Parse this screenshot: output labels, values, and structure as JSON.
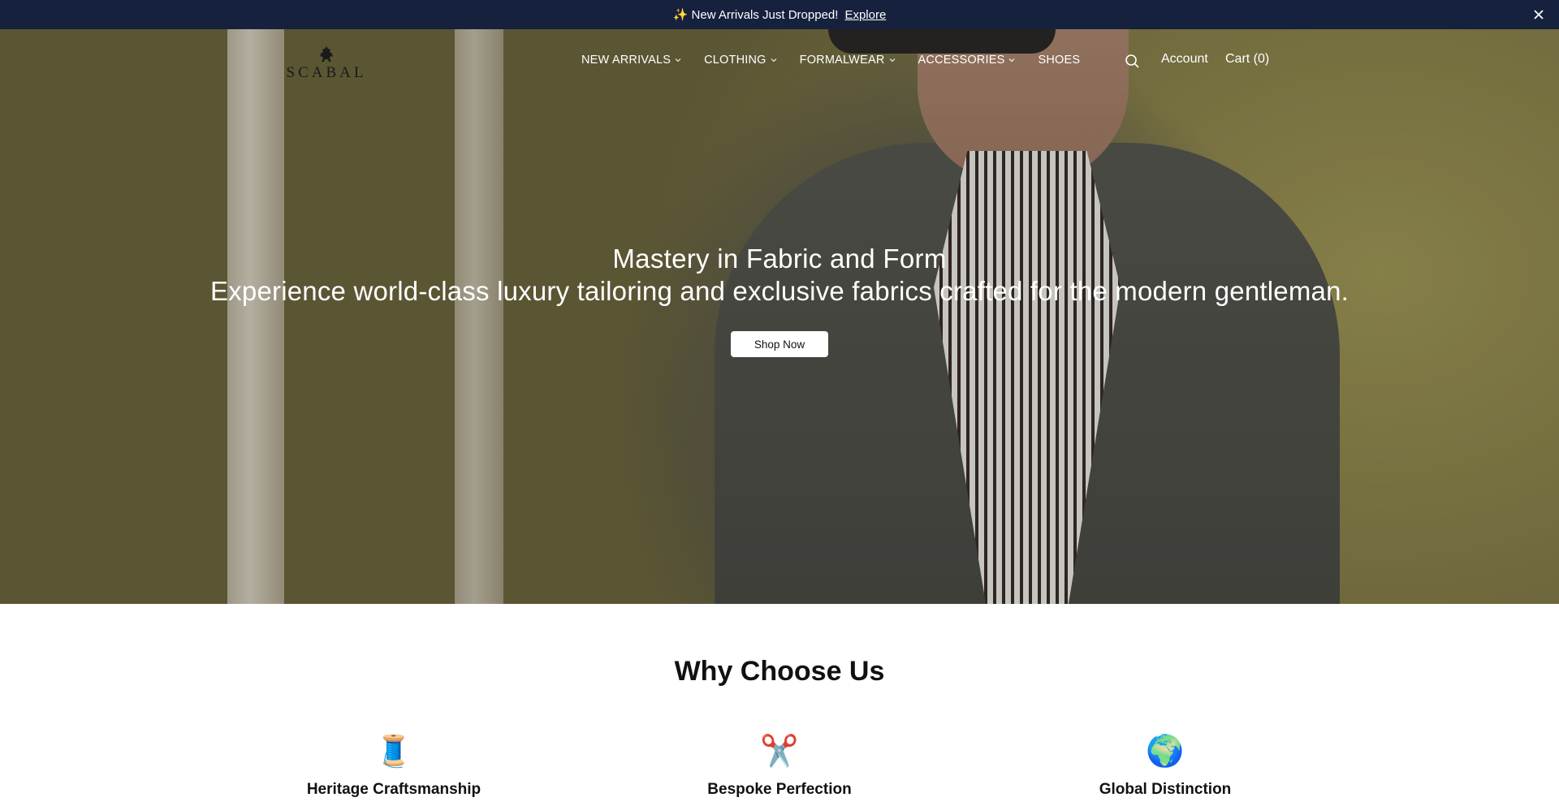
{
  "announcement": {
    "icon": "sparkles-icon",
    "text": "✨ New Arrivals Just Dropped!",
    "link_label": "Explore",
    "close_icon": "close-icon"
  },
  "brand": {
    "logo_text": "SCABAL"
  },
  "nav": {
    "items": [
      {
        "label": "NEW ARRIVALS",
        "has_dropdown": true
      },
      {
        "label": "CLOTHING",
        "has_dropdown": true
      },
      {
        "label": "FORMALWEAR",
        "has_dropdown": true
      },
      {
        "label": "ACCESSORIES",
        "has_dropdown": true
      },
      {
        "label": "SHOES",
        "has_dropdown": false
      }
    ]
  },
  "header_utils": {
    "search_icon": "search-icon",
    "account_label": "Account",
    "cart_label": "Cart (0)"
  },
  "hero": {
    "title": "Mastery in Fabric and Form",
    "subtitle": "Experience world-class luxury tailoring and exclusive fabrics crafted for the modern gentleman.",
    "cta_label": "Shop Now"
  },
  "why": {
    "title": "Why Choose Us",
    "features": [
      {
        "icon": "🧵",
        "title": "Heritage Craftsmanship"
      },
      {
        "icon": "✂️",
        "title": "Bespoke Perfection"
      },
      {
        "icon": "🌍",
        "title": "Global Distinction"
      }
    ]
  },
  "colors": {
    "announcement_bg": "#16213e",
    "button_bg": "#ffffff",
    "text_dark": "#111111"
  }
}
